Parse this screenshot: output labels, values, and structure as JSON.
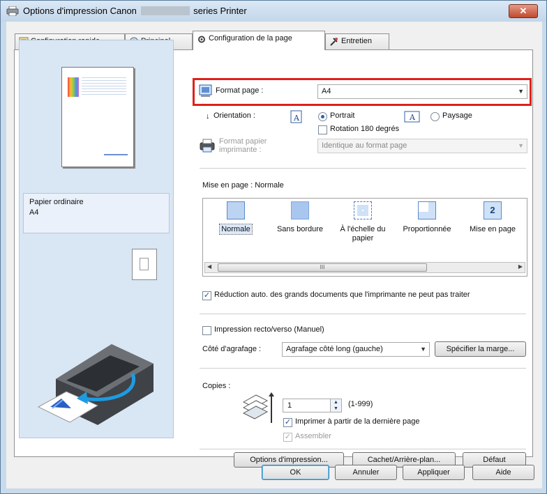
{
  "window": {
    "title_prefix": "Options d'impression Canon",
    "title_suffix": "series Printer",
    "close_label": "✕"
  },
  "tabs": [
    {
      "label": "Configuration rapide"
    },
    {
      "label": "Principal"
    },
    {
      "label": "Configuration de la page"
    },
    {
      "label": "Entretien"
    }
  ],
  "preview": {
    "media_type": "Papier ordinaire",
    "paper_size": "A4"
  },
  "page_setup": {
    "format_label": "Format page :",
    "format_value": "A4",
    "orientation_label": "Orientation :",
    "portrait_label": "Portrait",
    "landscape_label": "Paysage",
    "orientation_selected": "Portrait",
    "rotate_label": "Rotation 180 degrés",
    "rotate_checked": false,
    "printer_paper_label_1": "Format papier",
    "printer_paper_label_2": "imprimante :",
    "printer_paper_value": "Identique au format page",
    "layout_label": "Mise en page :",
    "layout_value": "Normale",
    "layouts": [
      {
        "label": "Normale",
        "label2": ""
      },
      {
        "label": "Sans bordure",
        "label2": ""
      },
      {
        "label": "À l'échelle du",
        "label2": "papier"
      },
      {
        "label": "Proportionnée",
        "label2": ""
      },
      {
        "label": "Mise en page",
        "label2": ""
      }
    ],
    "scroll_thumb": "III",
    "auto_reduce_label": "Réduction auto. des grands documents que l'imprimante ne peut pas traiter",
    "auto_reduce_checked": true,
    "duplex_label": "Impression recto/verso (Manuel)",
    "duplex_checked": false,
    "stapling_label": "Côté d'agrafage :",
    "stapling_value": "Agrafage côté long (gauche)",
    "margin_button": "Spécifier la marge...",
    "copies_label": "Copies :",
    "copies_value": "1",
    "copies_range": "(1-999)",
    "reverse_label": "Imprimer à partir de la dernière page",
    "reverse_checked": true,
    "collate_label": "Assembler",
    "collate_checked": true,
    "print_options_button": "Options d'impression...",
    "stamp_button": "Cachet/Arrière-plan...",
    "default_button": "Défaut",
    "layout_icon_number": "2"
  },
  "footer": {
    "ok": "OK",
    "cancel": "Annuler",
    "apply": "Appliquer",
    "help": "Aide"
  },
  "colors": {
    "highlight": "#e0201a",
    "preview_bg": "#d9e6f4",
    "accent": "#2a61b8"
  }
}
